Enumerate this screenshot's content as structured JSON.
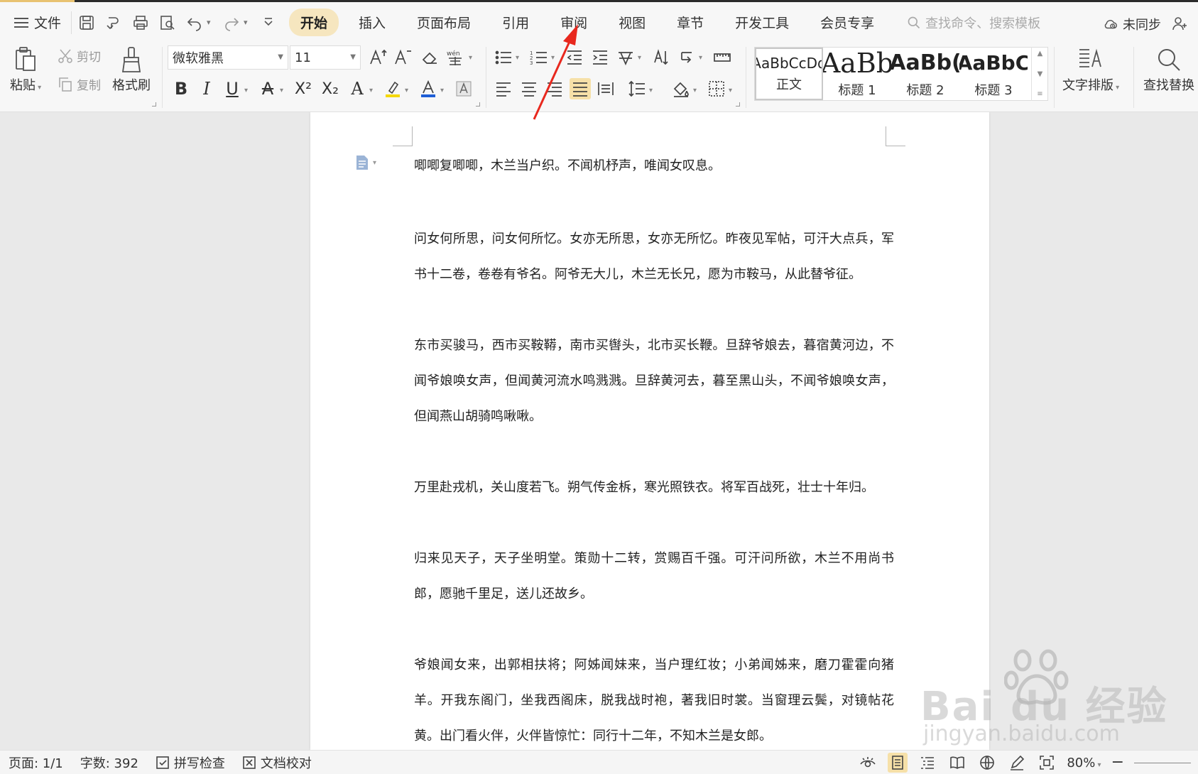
{
  "menubar": {
    "file_label": "文件",
    "tabs": [
      {
        "label": "开始",
        "active": true
      },
      {
        "label": "插入",
        "active": false
      },
      {
        "label": "页面布局",
        "active": false
      },
      {
        "label": "引用",
        "active": false
      },
      {
        "label": "审阅",
        "active": false
      },
      {
        "label": "视图",
        "active": false
      },
      {
        "label": "章节",
        "active": false
      },
      {
        "label": "开发工具",
        "active": false
      },
      {
        "label": "会员专享",
        "active": false
      }
    ],
    "search_placeholder": "查找命令、搜索模板",
    "sync_label": "未同步"
  },
  "ribbon": {
    "paste_label": "粘贴",
    "cut_label": "剪切",
    "copy_label": "复制",
    "format_painter_label": "格式刷",
    "font_name": "微软雅黑",
    "font_size": "11",
    "styles": [
      {
        "sample": "AaBbCcDd",
        "label": "正文"
      },
      {
        "sample": "AaBb",
        "label": "标题 1"
      },
      {
        "sample": "AaBb(",
        "label": "标题 2"
      },
      {
        "sample": "AaBbC",
        "label": "标题 3"
      }
    ],
    "text_layout_label": "文字排版",
    "find_replace_label": "查找替换"
  },
  "document": {
    "paragraphs": [
      "唧唧复唧唧，木兰当户织。不闻机杼声，唯闻女叹息。",
      "问女何所思，问女何所忆。女亦无所思，女亦无所忆。昨夜见军帖，可汗大点兵，军书十二卷，卷卷有爷名。阿爷无大儿，木兰无长兄，愿为市鞍马，从此替爷征。",
      "东市买骏马，西市买鞍鞯，南市买辔头，北市买长鞭。旦辞爷娘去，暮宿黄河边，不闻爷娘唤女声，但闻黄河流水鸣溅溅。旦辞黄河去，暮至黑山头，不闻爷娘唤女声，但闻燕山胡骑鸣啾啾。",
      "万里赴戎机，关山度若飞。朔气传金柝，寒光照铁衣。将军百战死，壮士十年归。",
      "归来见天子，天子坐明堂。策勋十二转，赏赐百千强。可汗问所欲，木兰不用尚书郎，愿驰千里足，送儿还故乡。",
      "爷娘闻女来，出郭相扶将；阿姊闻妹来，当户理红妆；小弟闻姊来，磨刀霍霍向猪羊。开我东阁门，坐我西阁床，脱我战时袍，著我旧时裳。当窗理云鬓，对镜帖花黄。出门看火伴，火伴皆惊忙：同行十二年，不知木兰是女郎。"
    ]
  },
  "watermark": {
    "logo": "Bai du 经验",
    "url": "jingyan.baidu.com"
  },
  "statusbar": {
    "page": "页面: 1/1",
    "word_count": "字数: 392",
    "spell_check": "拼写检查",
    "proofread": "文档校对",
    "zoom": "80%"
  }
}
